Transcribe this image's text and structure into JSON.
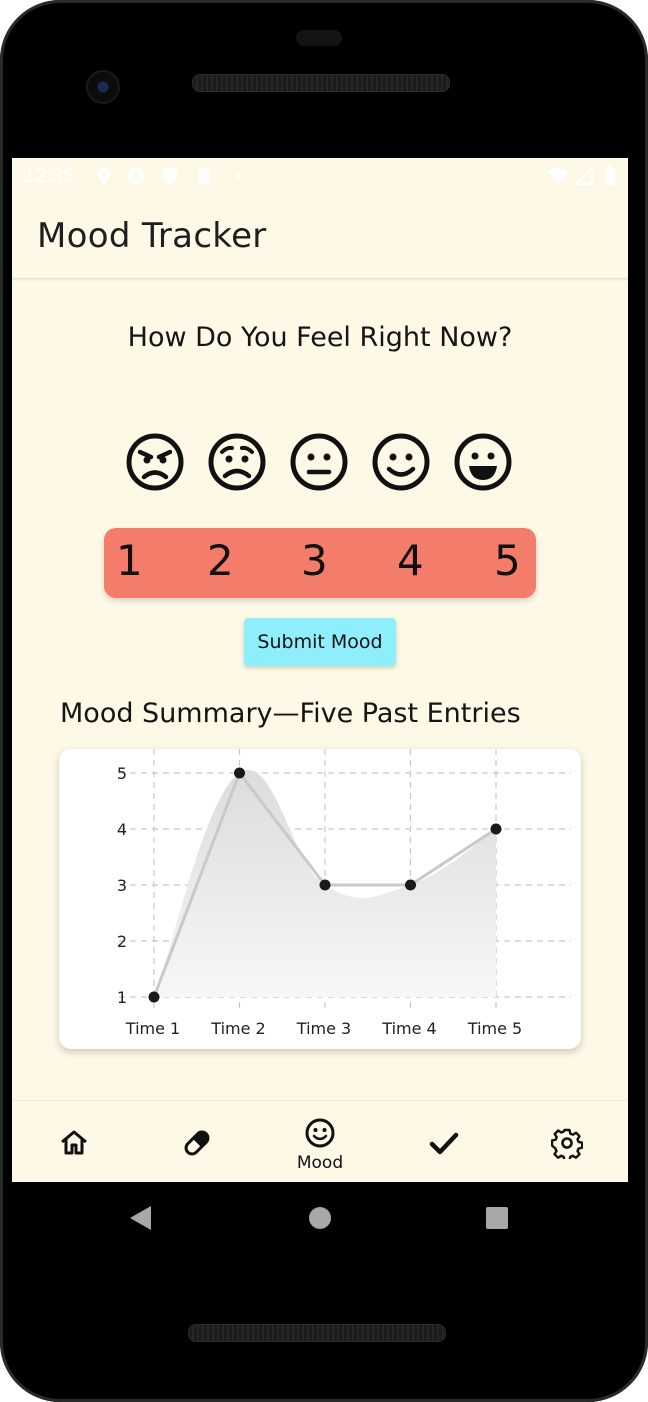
{
  "status_bar": {
    "time": "12:35"
  },
  "app_bar": {
    "title": "Mood Tracker"
  },
  "prompt": {
    "question": "How Do You Feel Right Now?"
  },
  "mood_faces": [
    "very-angry-face-icon",
    "sad-face-icon",
    "neutral-face-icon",
    "smile-face-icon",
    "grin-face-icon"
  ],
  "mood_scale": {
    "values": [
      "1",
      "2",
      "3",
      "4",
      "5"
    ],
    "color": "#f47c6b"
  },
  "submit_button": {
    "label": "Submit Mood",
    "color": "#8eeefb"
  },
  "summary": {
    "title": "Mood Summary—Five Past Entries"
  },
  "chart_data": {
    "type": "line",
    "categories": [
      "Time 1",
      "Time 2",
      "Time 3",
      "Time 4",
      "Time 5"
    ],
    "series": [
      {
        "values": [
          1,
          5,
          3,
          3,
          4
        ]
      }
    ],
    "y_ticks": [
      "1",
      "2",
      "3",
      "4",
      "5"
    ],
    "ylim": [
      1,
      5
    ],
    "grid": true,
    "area_fill": true
  },
  "bottom_nav": {
    "items": [
      {
        "icon": "home-icon",
        "label": ""
      },
      {
        "icon": "pill-icon",
        "label": ""
      },
      {
        "icon": "smile-icon",
        "label": "Mood"
      },
      {
        "icon": "checkmark-icon",
        "label": ""
      },
      {
        "icon": "gear-icon",
        "label": ""
      }
    ],
    "active_index": 2
  }
}
